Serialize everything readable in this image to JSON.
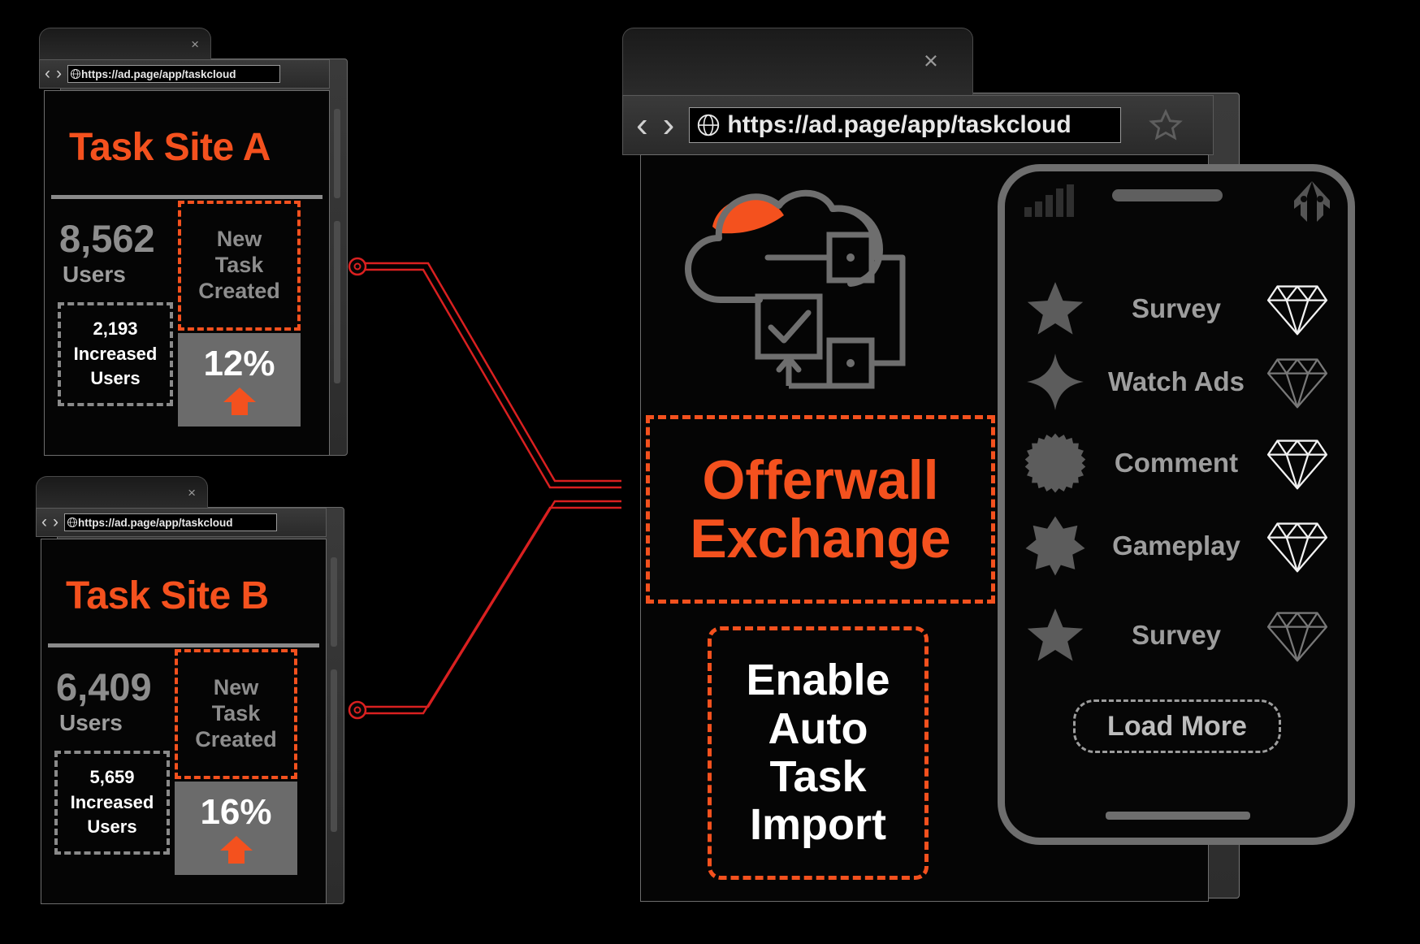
{
  "colors": {
    "orange": "#f4511e",
    "grey_text": "#8d8d8d",
    "white": "#ffffff",
    "connector_red": "#d92020",
    "background": "#000000"
  },
  "site_a": {
    "window_name": "Task Site A browser window",
    "url": "https://ad.page/app/taskcloud",
    "close_label": "×",
    "back_label": "‹",
    "forward_label": "›",
    "globe_icon": "globe-icon",
    "title": "Task Site A",
    "users_count": "8,562",
    "users_label": "Users",
    "new_task_lines": [
      "New",
      "Task",
      "Created"
    ],
    "increased_count": "2,193",
    "increased_lines": [
      "Increased",
      "Users"
    ],
    "percent": "12%"
  },
  "site_b": {
    "window_name": "Task Site B browser window",
    "url": "https://ad.page/app/taskcloud",
    "close_label": "×",
    "back_label": "‹",
    "forward_label": "›",
    "globe_icon": "globe-icon",
    "title": "Task Site B",
    "users_count": "6,409",
    "users_label": "Users",
    "new_task_lines": [
      "New",
      "Task",
      "Created"
    ],
    "increased_count": "5,659",
    "increased_lines": [
      "Increased",
      "Users"
    ],
    "percent": "16%"
  },
  "main_window": {
    "window_name": "Task Cloud main browser window",
    "url": "https://ad.page/app/taskcloud",
    "close_label": "×",
    "back_label": "‹",
    "forward_label": "›",
    "globe_icon": "globe-icon",
    "bookmark_icon": "star-icon",
    "hero_icon": "cloud-task-network-icon",
    "offerwall_line1": "Offerwall",
    "offerwall_line2": "Exchange",
    "enable_lines": [
      "Enable",
      "Auto",
      "Task",
      "Import"
    ]
  },
  "phone": {
    "device_name": "smartphone-mockup",
    "status_signal_icon": "signal-bars-icon",
    "status_speaker_icon": "speaker-grill-icon",
    "status_right_icon": "rocket-icon",
    "home_indicator_icon": "home-indicator",
    "offers": [
      {
        "icon": "star-5-icon",
        "label": "Survey",
        "reward_icon": "diamond-icon",
        "reward_bright": true
      },
      {
        "icon": "sparkle-4-icon",
        "label": "Watch Ads",
        "reward_icon": "diamond-icon",
        "reward_bright": false
      },
      {
        "icon": "burst-circle-icon",
        "label": "Comment",
        "reward_icon": "diamond-icon",
        "reward_bright": true
      },
      {
        "icon": "star-7-icon",
        "label": "Gameplay",
        "reward_icon": "diamond-icon",
        "reward_bright": true
      },
      {
        "icon": "star-5-icon",
        "label": "Survey",
        "reward_icon": "diamond-icon",
        "reward_bright": false
      }
    ],
    "load_more_label": "Load More"
  },
  "connectors": {
    "node_icon": "connection-node-icon",
    "count": 2
  }
}
